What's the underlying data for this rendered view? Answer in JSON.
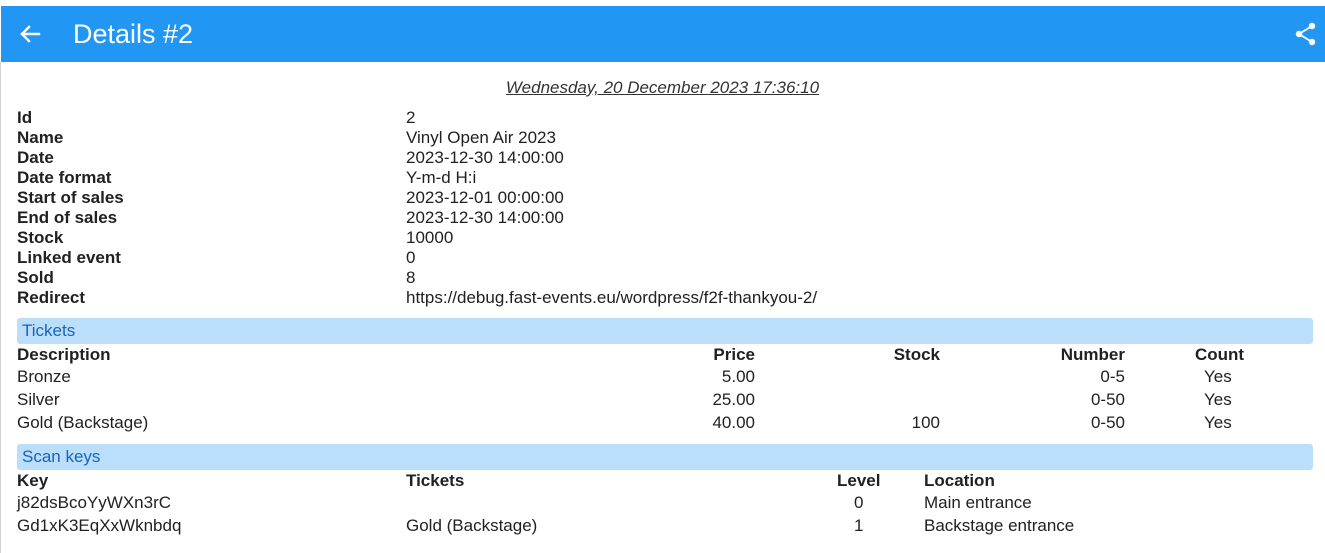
{
  "header": {
    "title": "Details #2",
    "back_icon": "arrow-left-icon",
    "share_icon": "share-icon"
  },
  "timestamp": "Wednesday, 20 December 2023 17:36:10",
  "details": [
    {
      "key": "Id",
      "value": "2"
    },
    {
      "key": "Name",
      "value": "Vinyl Open Air 2023"
    },
    {
      "key": "Date",
      "value": "2023-12-30 14:00:00"
    },
    {
      "key": "Date format",
      "value": "Y-m-d H:i"
    },
    {
      "key": "Start of sales",
      "value": "2023-12-01 00:00:00"
    },
    {
      "key": "End of sales",
      "value": "2023-12-30 14:00:00"
    },
    {
      "key": "Stock",
      "value": "10000"
    },
    {
      "key": "Linked event",
      "value": "0"
    },
    {
      "key": "Sold",
      "value": "8"
    },
    {
      "key": "Redirect",
      "value": "https://debug.fast-events.eu/wordpress/f2f-thankyou-2/"
    }
  ],
  "tickets": {
    "title": "Tickets",
    "columns": {
      "description": "Description",
      "price": "Price",
      "stock": "Stock",
      "number": "Number",
      "count": "Count"
    },
    "rows": [
      {
        "description": "Bronze",
        "price": "5.00",
        "stock": "",
        "number": "0-5",
        "count": "Yes"
      },
      {
        "description": "Silver",
        "price": "25.00",
        "stock": "",
        "number": "0-50",
        "count": "Yes"
      },
      {
        "description": "Gold (Backstage)",
        "price": "40.00",
        "stock": "100",
        "number": "0-50",
        "count": "Yes"
      }
    ]
  },
  "scan_keys": {
    "title": "Scan keys",
    "columns": {
      "key": "Key",
      "tickets": "Tickets",
      "level": "Level",
      "location": "Location"
    },
    "rows": [
      {
        "key": "j82dsBcoYyWXn3rC",
        "tickets": "",
        "level": "0",
        "location": "Main entrance"
      },
      {
        "key": "Gd1xK3EqXxWknbdq",
        "tickets": "Gold (Backstage)",
        "level": "1",
        "location": "Backstage entrance"
      }
    ]
  }
}
